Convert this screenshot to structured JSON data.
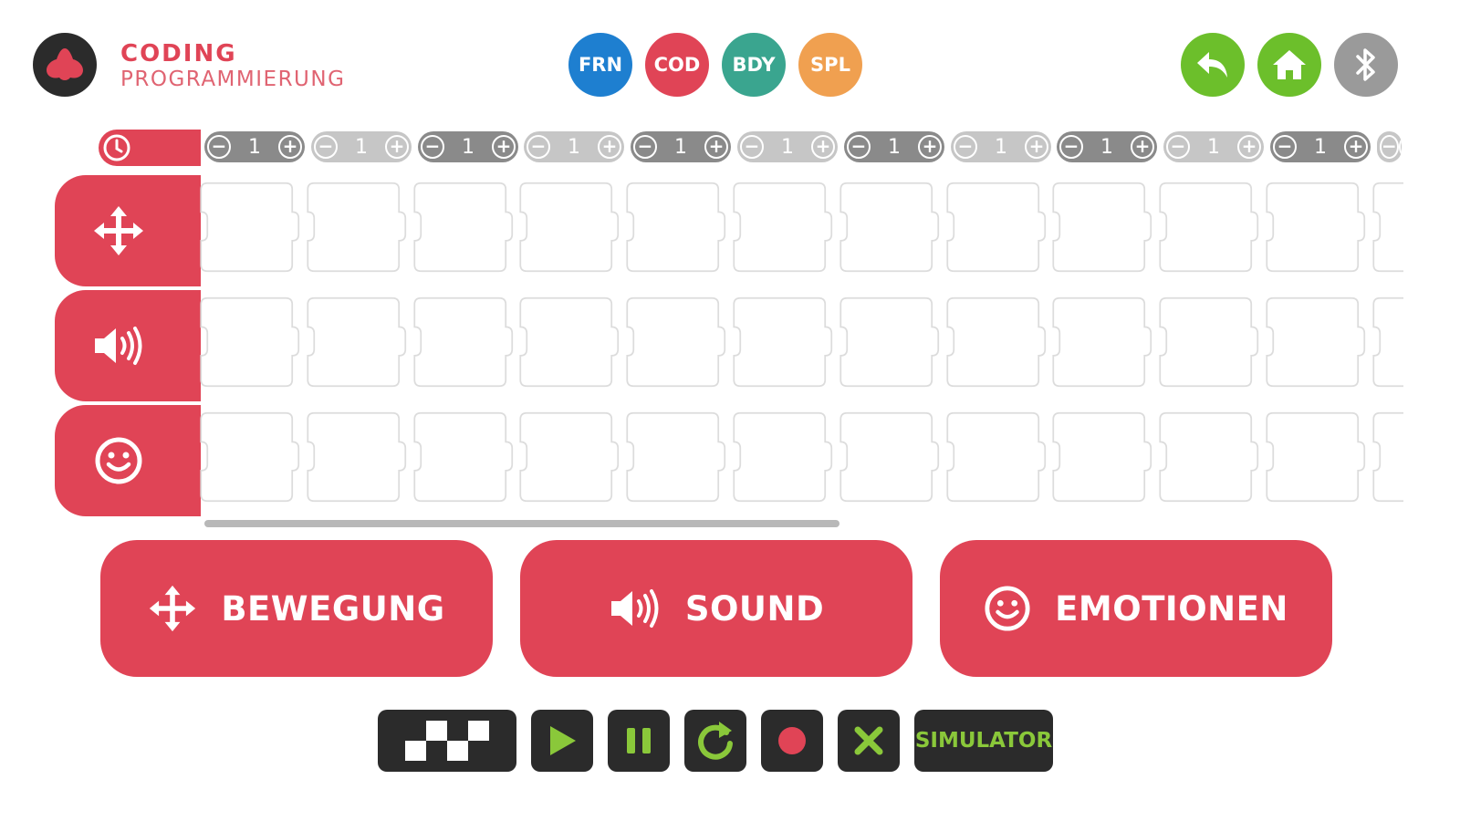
{
  "header": {
    "title": "CODING",
    "subtitle": "PROGRAMMIERUNG",
    "modes": [
      {
        "label": "FRN",
        "color": "#1e7fd0"
      },
      {
        "label": "COD",
        "color": "#e04456"
      },
      {
        "label": "BDY",
        "color": "#3aa58f"
      },
      {
        "label": "SPL",
        "color": "#f0a050"
      }
    ],
    "nav": [
      {
        "icon": "back-arrow-icon",
        "color": "#6cbf2b"
      },
      {
        "icon": "home-icon",
        "color": "#6cbf2b"
      },
      {
        "icon": "bluetooth-icon",
        "color": "#9a9a9a"
      }
    ]
  },
  "timeline": {
    "timer_icon": "clock-icon",
    "steppers": [
      {
        "value": "1",
        "color": "#8a8a8a"
      },
      {
        "value": "1",
        "color": "#c6c6c6"
      },
      {
        "value": "1",
        "color": "#8a8a8a"
      },
      {
        "value": "1",
        "color": "#c6c6c6"
      },
      {
        "value": "1",
        "color": "#8a8a8a"
      },
      {
        "value": "1",
        "color": "#c6c6c6"
      },
      {
        "value": "1",
        "color": "#8a8a8a"
      },
      {
        "value": "1",
        "color": "#c6c6c6"
      },
      {
        "value": "1",
        "color": "#8a8a8a"
      },
      {
        "value": "1",
        "color": "#c6c6c6"
      },
      {
        "value": "1",
        "color": "#8a8a8a"
      },
      {
        "value": "",
        "color": "#c6c6c6"
      }
    ]
  },
  "tracks": [
    {
      "icon": "move-arrows-icon"
    },
    {
      "icon": "speaker-icon"
    },
    {
      "icon": "smiley-icon"
    }
  ],
  "categories": [
    {
      "label": "BEWEGUNG",
      "icon": "move-arrows-icon"
    },
    {
      "label": "SOUND",
      "icon": "speaker-icon"
    },
    {
      "label": "EMOTIONEN",
      "icon": "smiley-icon"
    }
  ],
  "controls": {
    "checker_icon": "checkered-flag-icon",
    "play_icon": "play-icon",
    "pause_icon": "pause-icon",
    "repeat_icon": "repeat-icon",
    "record_icon": "record-icon",
    "clear_icon": "close-icon",
    "simulator_label": "SIMULATOR",
    "accent": "#8ac83a",
    "record_color": "#e04456"
  },
  "colors": {
    "brand": "#e04456",
    "dark": "#2b2b2b"
  }
}
